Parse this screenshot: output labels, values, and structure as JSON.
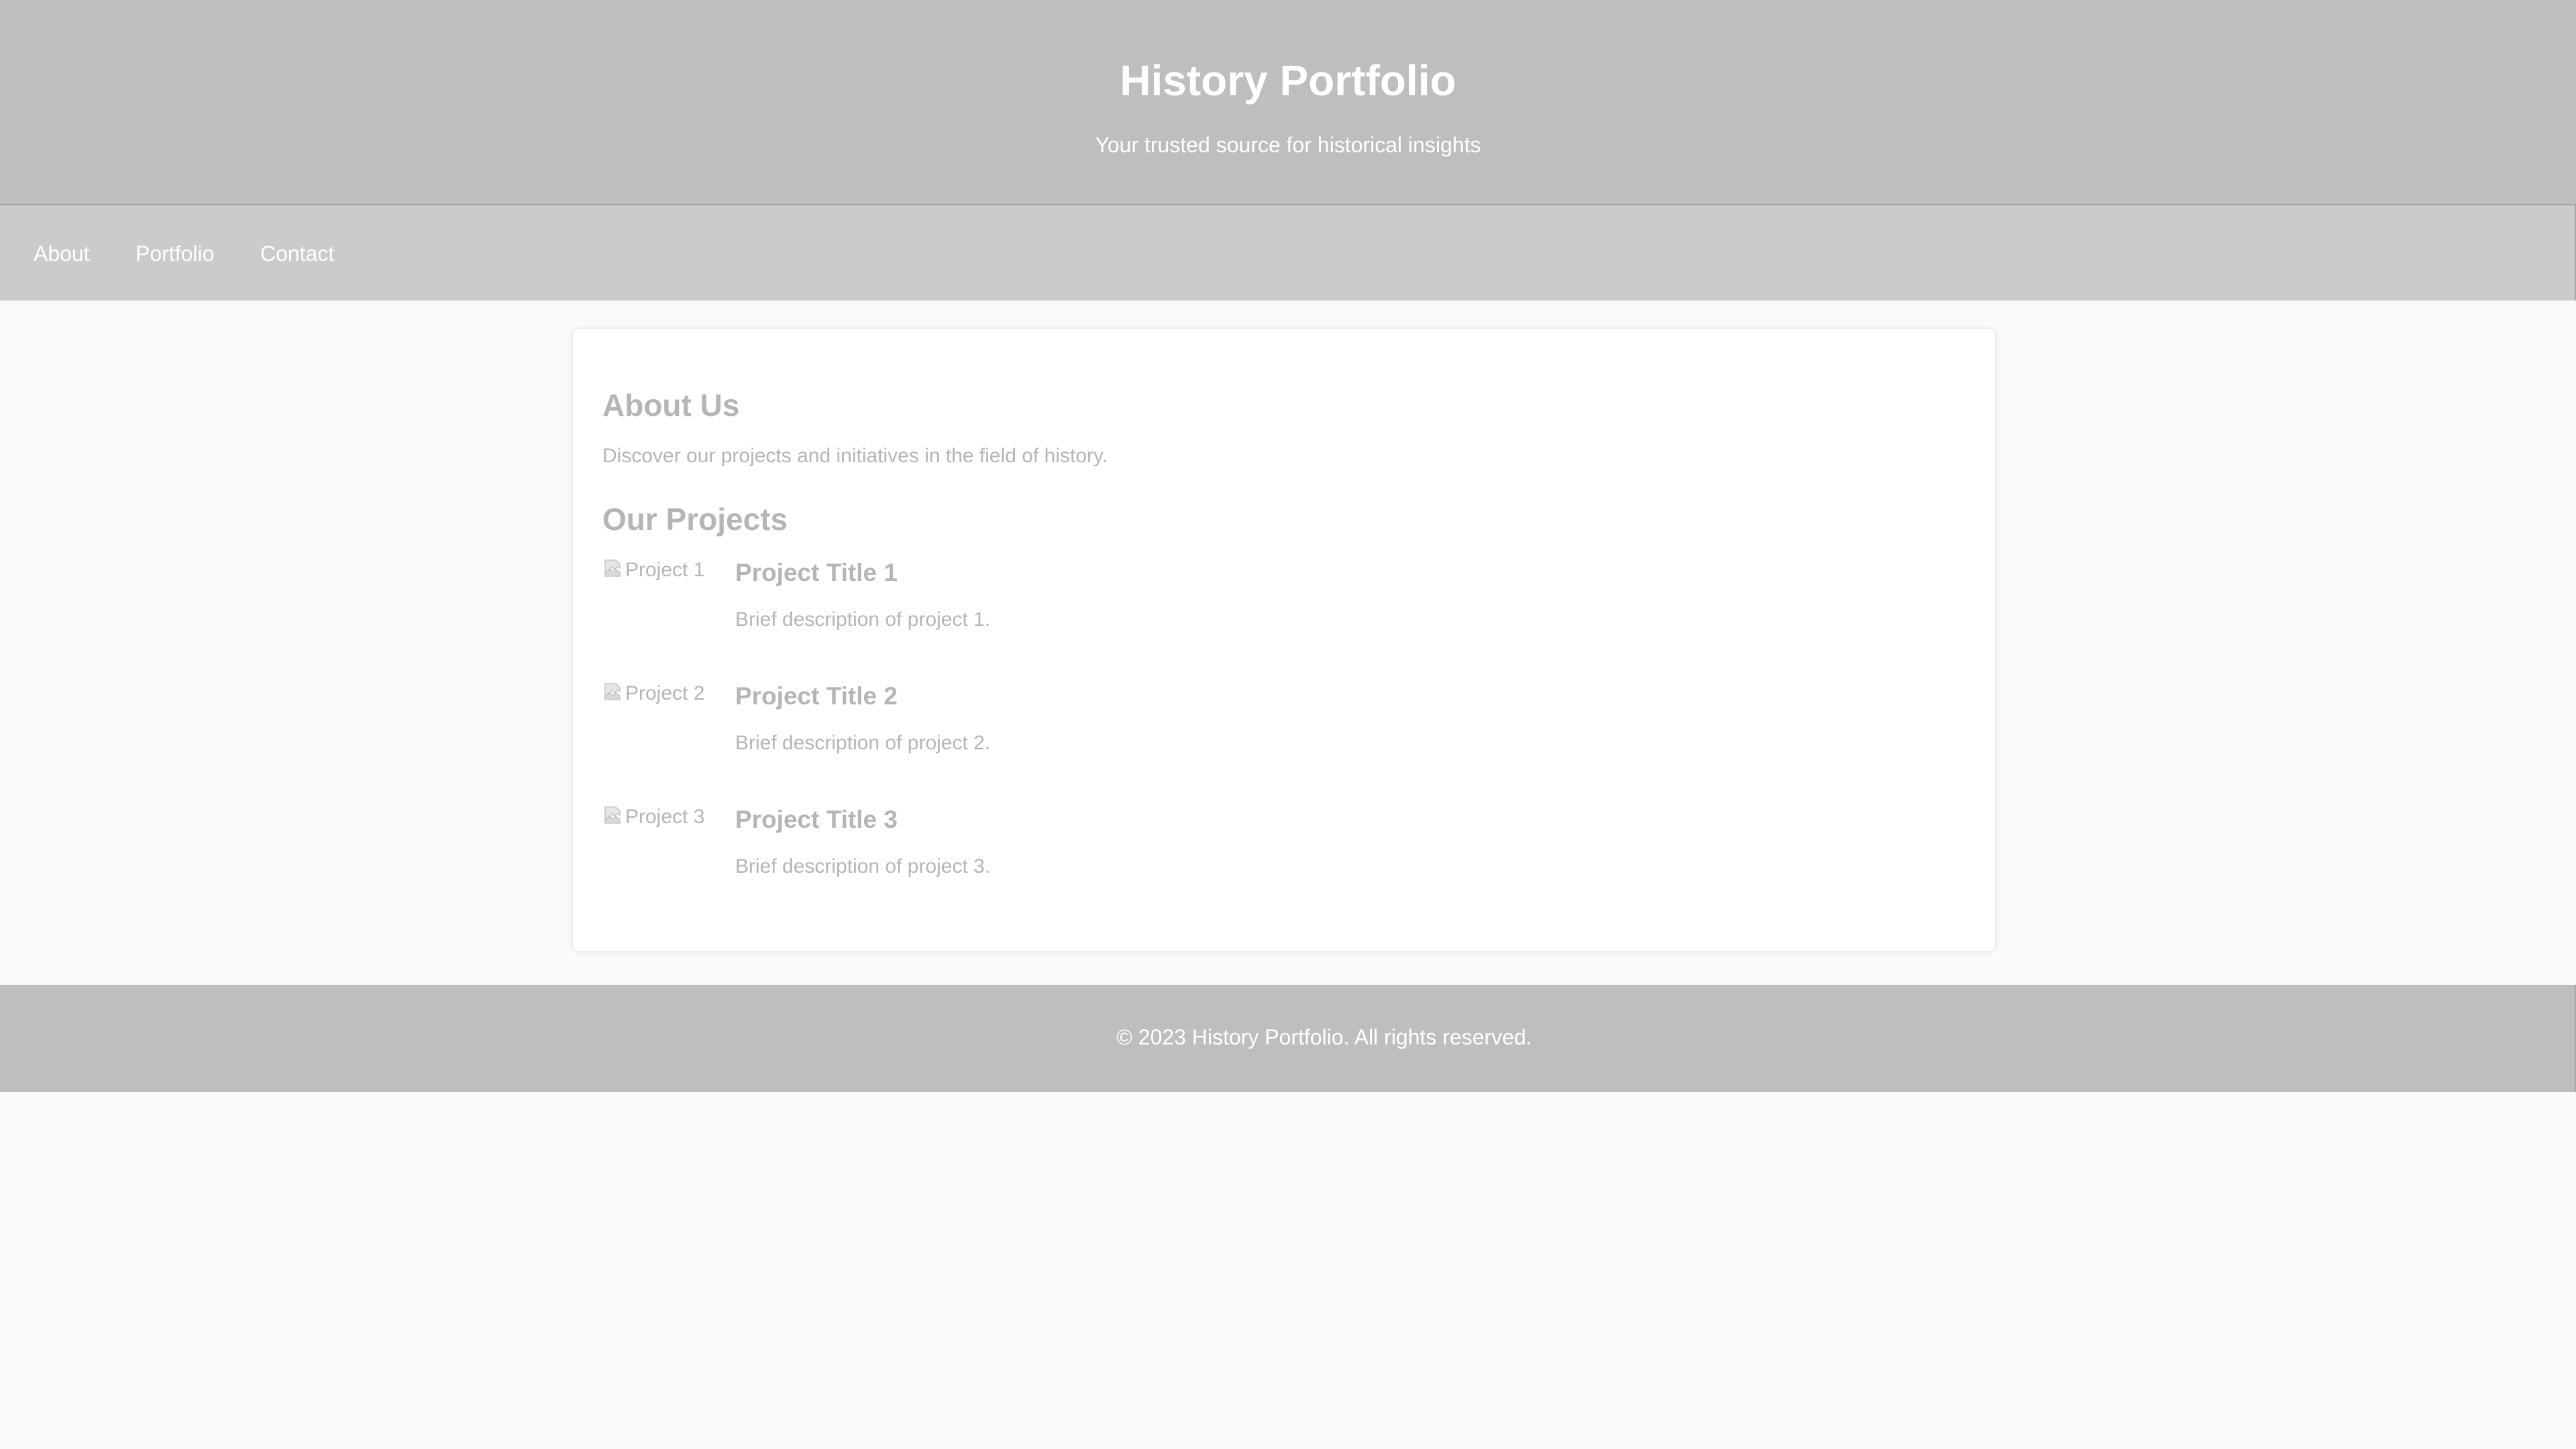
{
  "header": {
    "title": "History Portfolio",
    "tagline": "Your trusted source for historical insights"
  },
  "nav": {
    "items": [
      {
        "label": "About"
      },
      {
        "label": "Portfolio"
      },
      {
        "label": "Contact"
      }
    ]
  },
  "about": {
    "title": "About Us",
    "text": "Discover our projects and initiatives in the field of history."
  },
  "projects": {
    "title": "Our Projects",
    "items": [
      {
        "image_alt": "Project 1",
        "title": "Project Title 1",
        "description": "Brief description of project 1."
      },
      {
        "image_alt": "Project 2",
        "title": "Project Title 2",
        "description": "Brief description of project 2."
      },
      {
        "image_alt": "Project 3",
        "title": "Project Title 3",
        "description": "Brief description of project 3."
      }
    ]
  },
  "footer": {
    "copyright": "© 2023 History Portfolio. All rights reserved."
  },
  "icons": {
    "broken_image": "broken-image-icon"
  },
  "colors": {
    "header_bg": "#bebebe",
    "nav_bg": "#cbcbcb",
    "footer_bg": "#bebebe",
    "page_bg": "#fafafa",
    "card_text": "#b5b5b5"
  }
}
